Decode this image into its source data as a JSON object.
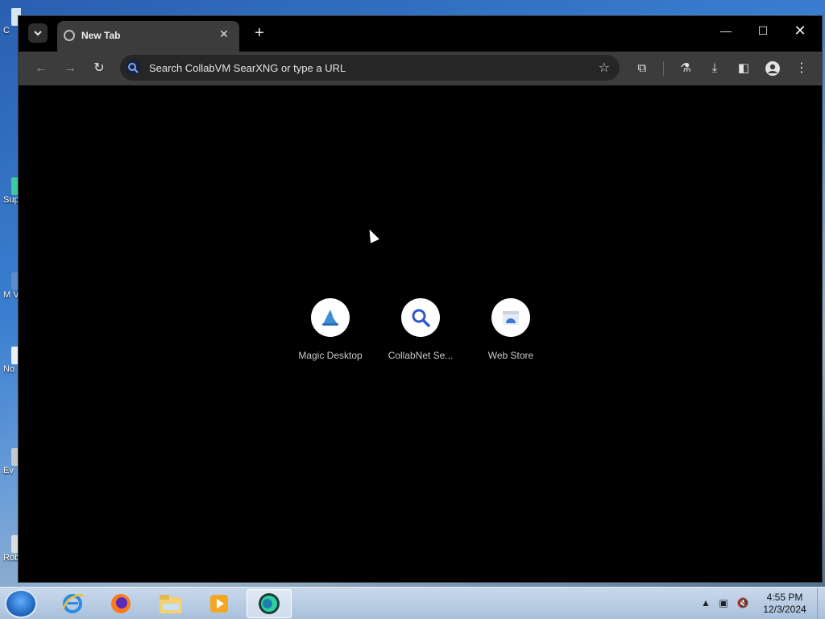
{
  "browser": {
    "tab": {
      "title": "New Tab"
    },
    "omnibox": {
      "placeholder": "Search CollabVM SearXNG or type a URL"
    },
    "shortcuts": [
      {
        "label": "Magic Desktop",
        "icon": "wizard-hat-icon"
      },
      {
        "label": "CollabNet Se...",
        "icon": "magnifier-icon"
      },
      {
        "label": "Web Store",
        "icon": "web-store-icon"
      }
    ]
  },
  "desktop": {
    "icons": [
      {
        "label": "C"
      },
      {
        "label": "Sup"
      },
      {
        "label": "M Vis"
      },
      {
        "label": "No"
      },
      {
        "label": "Ev"
      },
      {
        "label": "Rob"
      }
    ]
  },
  "taskbar": {
    "clock_time": "4:55 PM",
    "clock_date": "12/3/2024"
  }
}
